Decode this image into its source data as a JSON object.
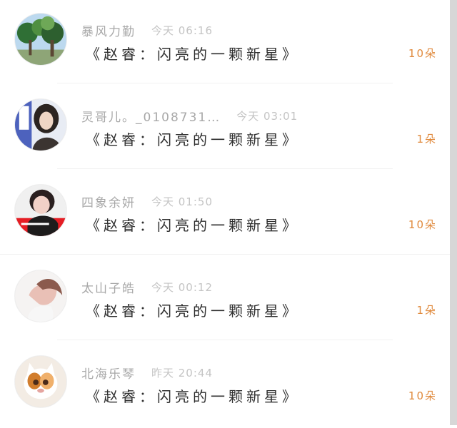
{
  "items": [
    {
      "username": "暴风力勤",
      "time": "今天 06:16",
      "gift": "《赵睿：闪亮的一颗新星》",
      "count": "10朵",
      "avatar_icon": "trees-avatar"
    },
    {
      "username": "灵哥儿。_0108731…",
      "time": "今天 03:01",
      "gift": "《赵睿：闪亮的一颗新星》",
      "count": "1朵",
      "avatar_icon": "woman-avatar"
    },
    {
      "username": "四象余妍",
      "time": "今天 01:50",
      "gift": "《赵睿：闪亮的一颗新星》",
      "count": "10朵",
      "avatar_icon": "man-red-avatar"
    },
    {
      "username": "太山子皓",
      "time": "今天 00:12",
      "gift": "《赵睿：闪亮的一颗新星》",
      "count": "1朵",
      "avatar_icon": "profile-avatar"
    },
    {
      "username": "北海乐琴",
      "time": "昨天 20:44",
      "gift": "《赵睿：闪亮的一颗新星》",
      "count": "10朵",
      "avatar_icon": "cat-avatar"
    }
  ]
}
